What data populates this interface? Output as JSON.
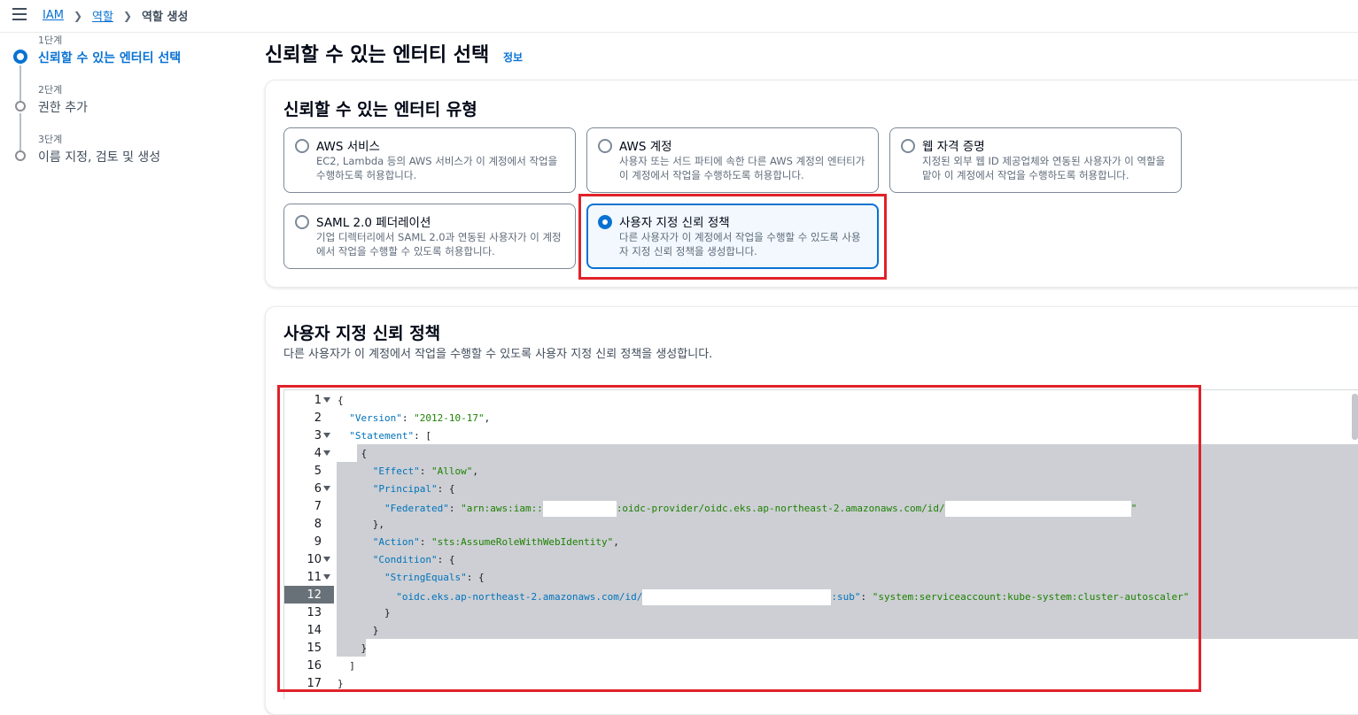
{
  "breadcrumb": {
    "items": [
      "IAM",
      "역할"
    ],
    "current": "역할 생성"
  },
  "steps": [
    {
      "num": "1단계",
      "title": "신뢰할 수 있는 엔터티 선택",
      "active": true
    },
    {
      "num": "2단계",
      "title": "권한 추가",
      "active": false
    },
    {
      "num": "3단계",
      "title": "이름 지정, 검토 및 생성",
      "active": false
    }
  ],
  "page": {
    "title": "신뢰할 수 있는 엔터티 선택",
    "info": "정보"
  },
  "entity_type": {
    "heading": "신뢰할 수 있는 엔터티 유형",
    "options": [
      {
        "title": "AWS 서비스",
        "desc": "EC2, Lambda 등의 AWS 서비스가 이 계정에서 작업을 수행하도록 허용합니다."
      },
      {
        "title": "AWS 계정",
        "desc": "사용자 또는 서드 파티에 속한 다른 AWS 계정의 엔터티가 이 계정에서 작업을 수행하도록 허용합니다."
      },
      {
        "title": "웹 자격 증명",
        "desc": "지정된 외부 웹 ID 제공업체와 연동된 사용자가 이 역할을 맡아 이 계정에서 작업을 수행하도록 허용합니다."
      },
      {
        "title": "SAML 2.0 페더레이션",
        "desc": "기업 디렉터리에서 SAML 2.0과 연동된 사용자가 이 계정에서 작업을 수행할 수 있도록 허용합니다."
      },
      {
        "title": "사용자 지정 신뢰 정책",
        "desc": "다른 사용자가 이 계정에서 작업을 수행할 수 있도록 사용자 지정 신뢰 정책을 생성합니다.",
        "selected": true
      }
    ]
  },
  "custom_policy": {
    "heading": "사용자 지정 신뢰 정책",
    "desc": "다른 사용자가 이 계정에서 작업을 수행할 수 있도록 사용자 지정 신뢰 정책을 생성합니다."
  },
  "editor": {
    "line_numbers": [
      "1",
      "2",
      "3",
      "4",
      "5",
      "6",
      "7",
      "8",
      "9",
      "10",
      "11",
      "12",
      "13",
      "14",
      "15",
      "16",
      "17"
    ],
    "current_line": "12",
    "tokens": {
      "l1": "{",
      "version_key": "\"Version\"",
      "version_val": "\"2012-10-17\"",
      "statement_key": "\"Statement\"",
      "l3_tail": ": [",
      "l4": "{",
      "effect_key": "\"Effect\"",
      "effect_val": "\"Allow\"",
      "principal_key": "\"Principal\"",
      "federated_key": "\"Federated\"",
      "federated_val_a": "\"arn:aws:iam::",
      "federated_val_b": ":oidc-provider/oidc.eks.ap-northeast-2.amazonaws.com/id/",
      "federated_val_c": "\"",
      "l8": "},",
      "action_key": "\"Action\"",
      "action_val": "\"sts:AssumeRoleWithWebIdentity\"",
      "condition_key": "\"Condition\"",
      "stringequals_key": "\"StringEquals\"",
      "cond_key_a": "\"oidc.eks.ap-northeast-2.amazonaws.com/id/",
      "cond_key_b": ":sub\"",
      "cond_val": "\"system:serviceaccount:kube-system:cluster-autoscaler\"",
      "l13": "}",
      "l14": "}",
      "l15": "}",
      "l16": "]",
      "l17": "}"
    }
  }
}
